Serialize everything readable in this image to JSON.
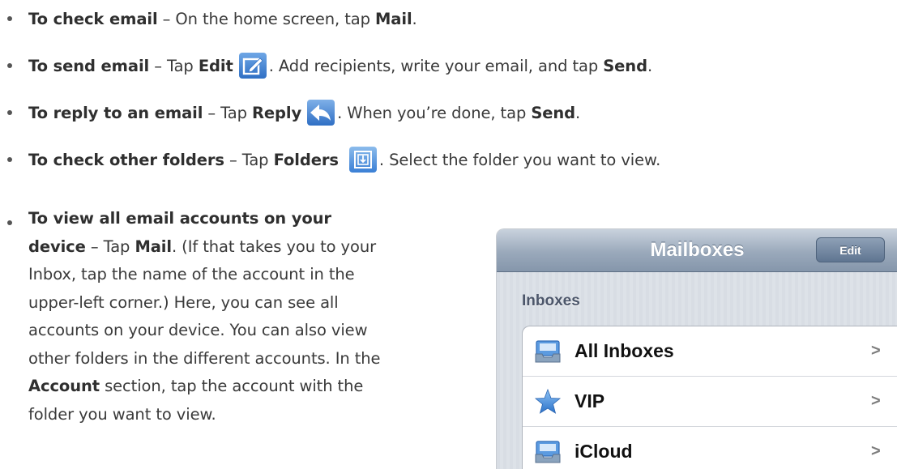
{
  "bullets": [
    {
      "bold": "To check email",
      "text1": " – On the home screen, tap ",
      "bold2": "Mail",
      "text2": "."
    },
    {
      "bold": "To send email",
      "text1": " – Tap ",
      "bold2": "Edit",
      "text2": ". Add recipients, write your email, and tap ",
      "bold3": "Send",
      "text3": "."
    },
    {
      "bold": "To reply to an email",
      "text1": " – Tap ",
      "bold2": "Reply",
      "text2": ". When you’re done, tap ",
      "bold3": "Send",
      "text3": "."
    },
    {
      "bold": "To check other folders",
      "text1": " – Tap ",
      "bold2": "Folders",
      "text2": ". Select the folder you want to view."
    }
  ],
  "para": {
    "bold": "To view all email accounts on your device",
    "t1": " – Tap ",
    "bold2": "Mail",
    "t2": ". (If that takes you to your Inbox, tap the name of the account in the upper-left corner.) Here, you can see all accounts on your device. You can also view other folders in the different accounts. In the ",
    "bold3": "Account",
    "t3": " section, tap the account with the folder you want to view."
  },
  "phone": {
    "title": "Mailboxes",
    "edit_label": "Edit",
    "section": "Inboxes",
    "rows": [
      {
        "label": "All Inboxes",
        "icon": "inbox-tray-icon",
        "chevron": ">"
      },
      {
        "label": "VIP",
        "icon": "star-icon",
        "chevron": ">"
      },
      {
        "label": "iCloud",
        "icon": "inbox-tray-icon",
        "chevron": ">"
      }
    ]
  },
  "icons": {
    "compose": "compose-icon",
    "reply": "reply-arrow-icon",
    "folders": "folders-icon"
  },
  "colors": {
    "accent_blue": "#3a7fd5",
    "nav_bar": "#8fa0b5"
  }
}
